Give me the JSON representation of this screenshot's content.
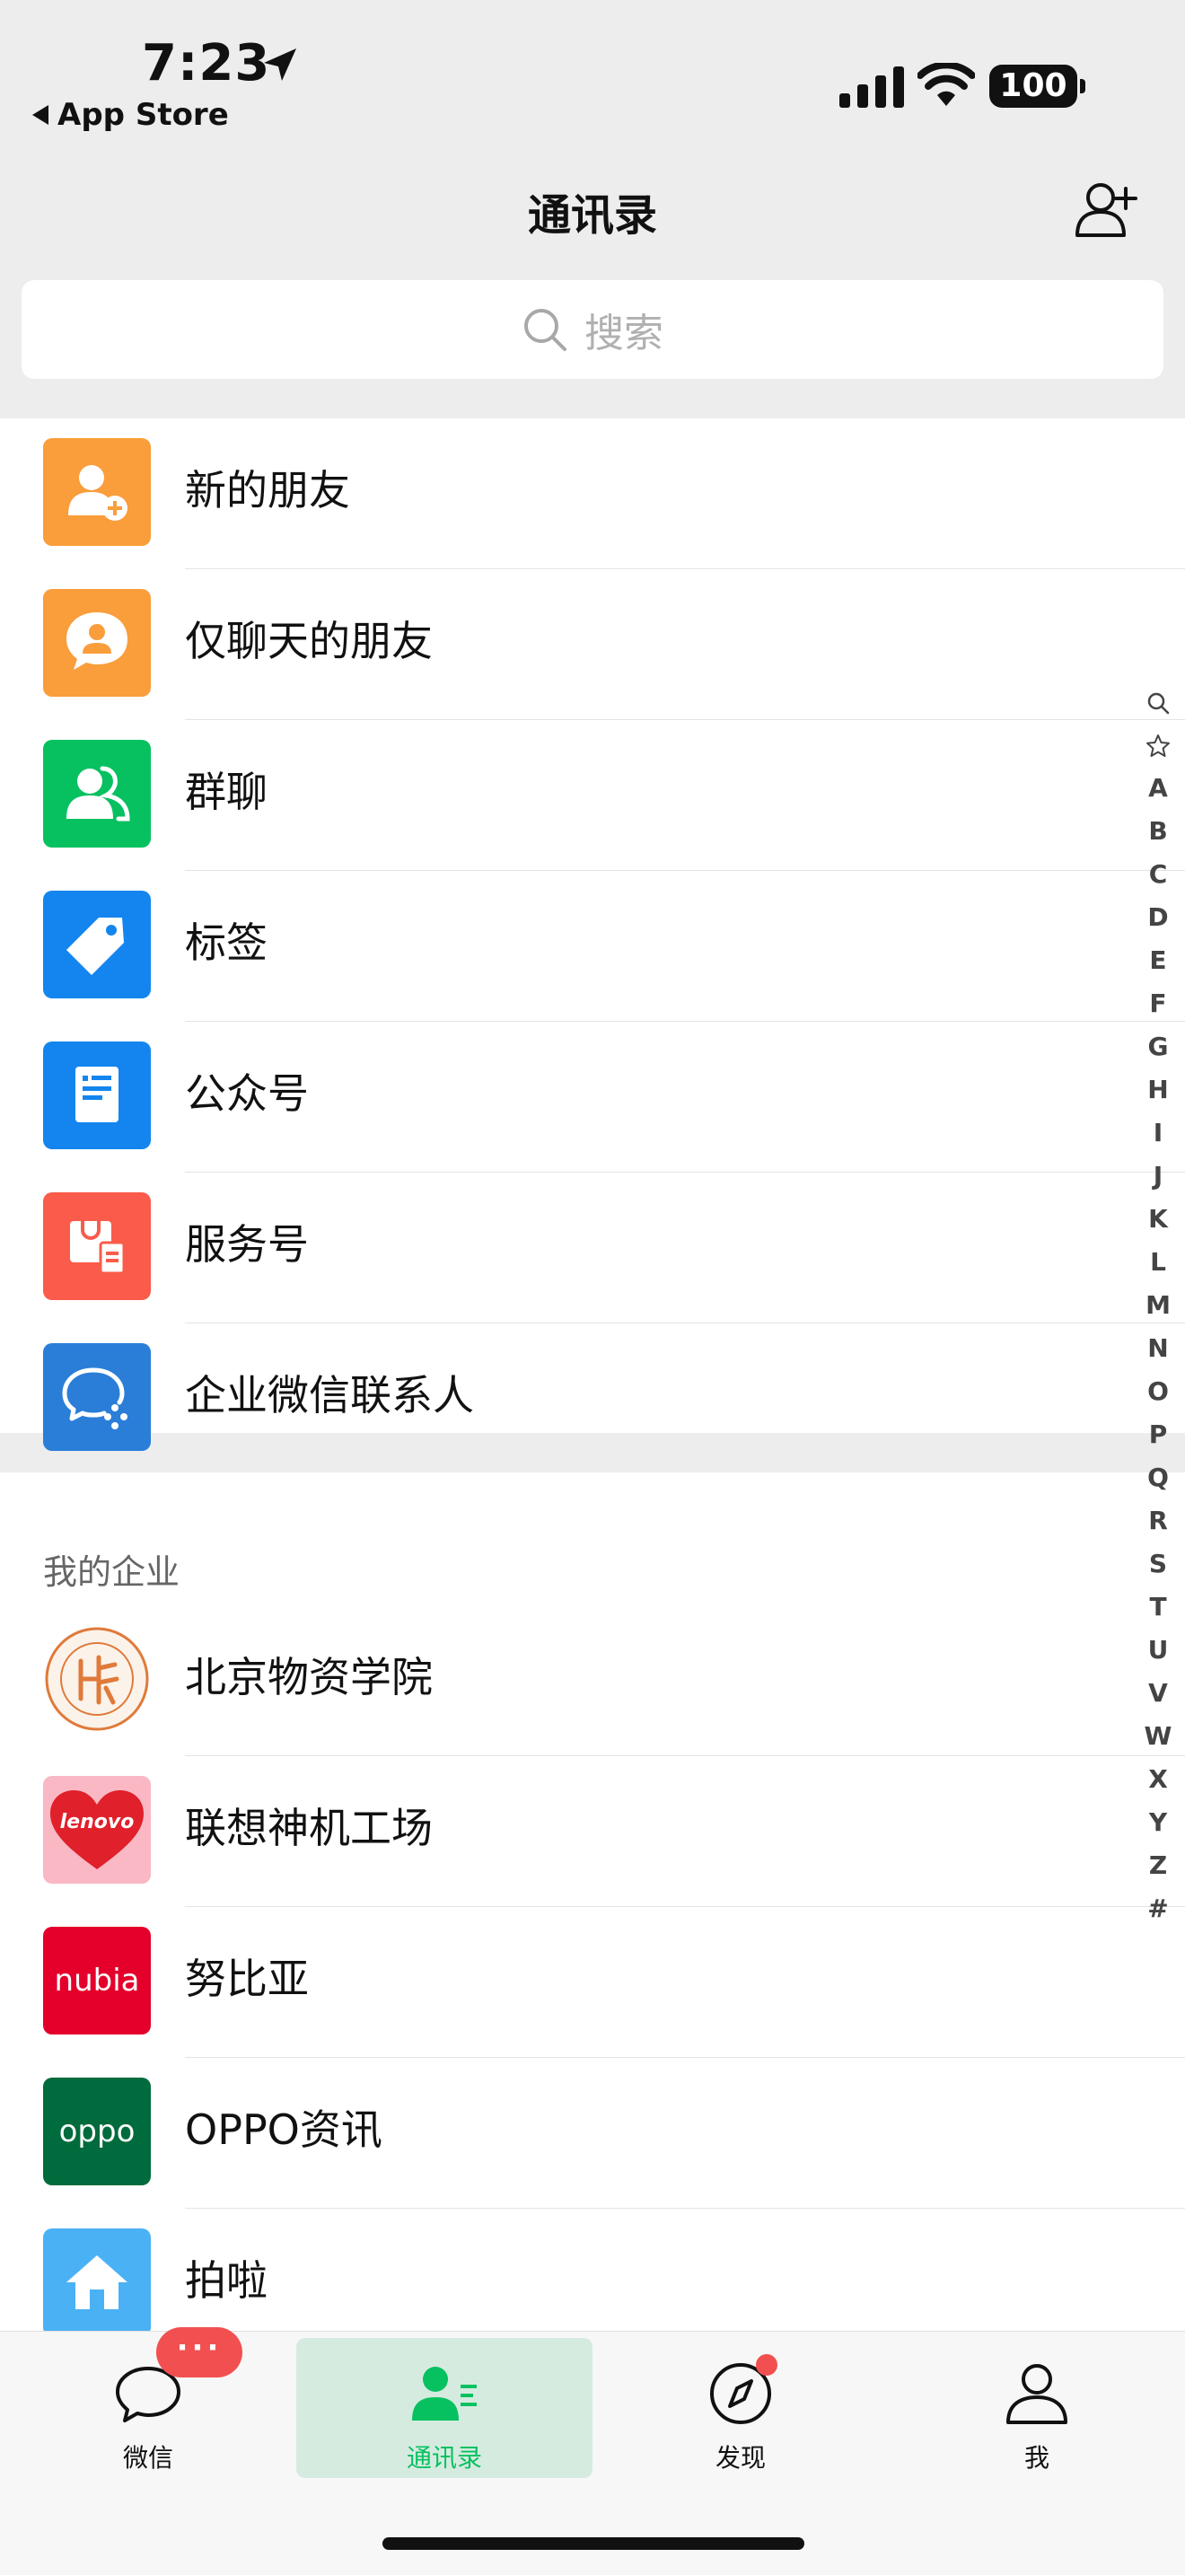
{
  "status": {
    "time": "7:23",
    "back_app": "App Store",
    "battery": "100"
  },
  "header": {
    "title": "通讯录"
  },
  "search": {
    "placeholder": "搜索"
  },
  "entries": [
    {
      "label": "新的朋友",
      "icon": "add-person-icon",
      "color": "#fa9d3b"
    },
    {
      "label": "仅聊天的朋友",
      "icon": "chat-person-icon",
      "color": "#fa9d3b"
    },
    {
      "label": "群聊",
      "icon": "group-icon",
      "color": "#07c160"
    },
    {
      "label": "标签",
      "icon": "tag-icon",
      "color": "#1485ee"
    },
    {
      "label": "公众号",
      "icon": "official-account-icon",
      "color": "#1485ee"
    },
    {
      "label": "服务号",
      "icon": "service-account-icon",
      "color": "#fa5b4a"
    },
    {
      "label": "企业微信联系人",
      "icon": "wecom-icon",
      "color": "#2a7ed8"
    }
  ],
  "my_enterprise": {
    "heading": "我的企业",
    "items": [
      {
        "label": "北京物资学院",
        "icon": "school-seal-icon"
      },
      {
        "label": "联想神机工场",
        "icon": "lenovo-heart-icon",
        "logo_text": "lenovo",
        "color": "#e0202a"
      },
      {
        "label": "努比亚",
        "icon": "nubia-logo-icon",
        "logo_text": "nubia",
        "color": "#e4002b"
      },
      {
        "label": "OPPO资讯",
        "icon": "oppo-logo-icon",
        "logo_text": "oppo",
        "color": "#006b3c"
      },
      {
        "label": "拍啦",
        "icon": "home-icon",
        "color": "#4ab1f5"
      }
    ]
  },
  "index_letters": [
    "A",
    "B",
    "C",
    "D",
    "E",
    "F",
    "G",
    "H",
    "I",
    "J",
    "K",
    "L",
    "M",
    "N",
    "O",
    "P",
    "Q",
    "R",
    "S",
    "T",
    "U",
    "V",
    "W",
    "X",
    "Y",
    "Z",
    "#"
  ],
  "tabbar": {
    "tabs": [
      {
        "label": "微信",
        "icon": "chat-bubble-icon"
      },
      {
        "label": "通讯录",
        "icon": "contacts-icon",
        "active": true
      },
      {
        "label": "发现",
        "icon": "compass-icon"
      },
      {
        "label": "我",
        "icon": "profile-icon"
      }
    ],
    "chat_badge": "···",
    "accent": "#07c160"
  }
}
